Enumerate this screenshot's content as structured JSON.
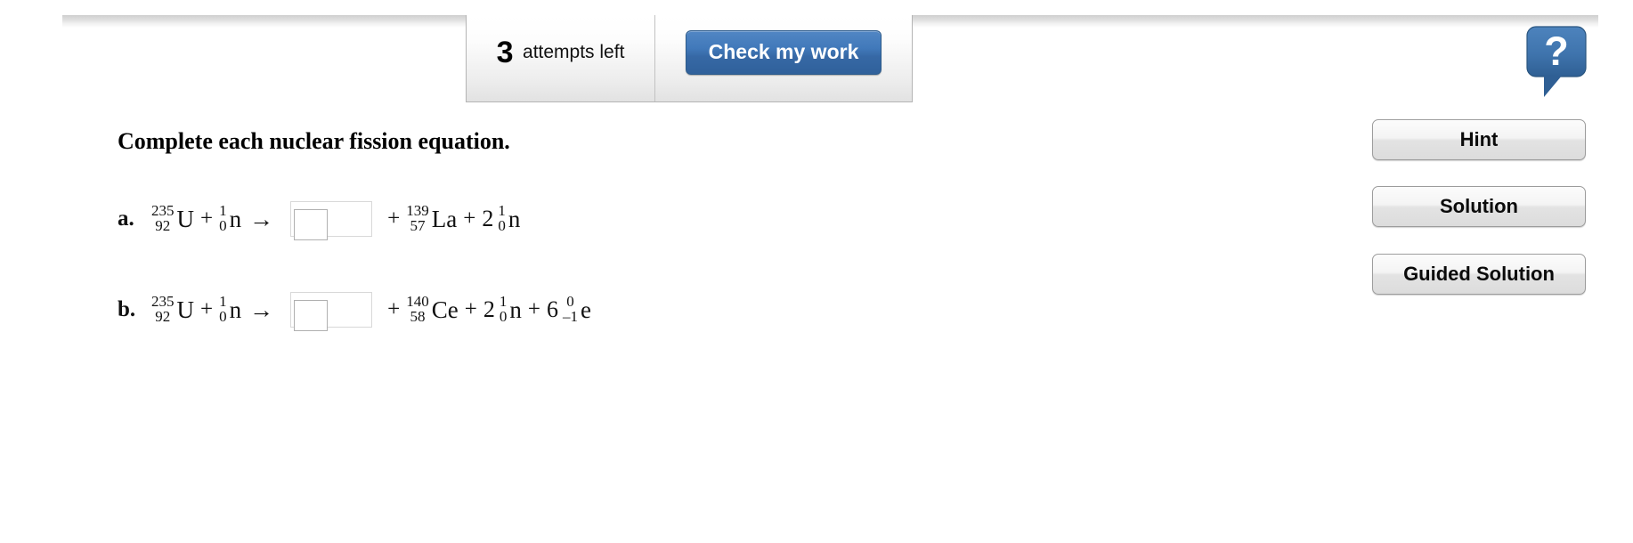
{
  "toolbar": {
    "attempts_count": "3",
    "attempts_label": "attempts left",
    "check_button_label": "Check my work"
  },
  "help": {
    "icon": "question-mark-speech-bubble-icon",
    "glyph": "?"
  },
  "question": {
    "title": "Complete each nuclear fission equation.",
    "equations": [
      {
        "label": "a.",
        "terms": [
          {
            "kind": "isotope",
            "mass": "235",
            "z": "92",
            "symbol": "U"
          },
          {
            "kind": "op",
            "text": "+"
          },
          {
            "kind": "isotope",
            "mass": "1",
            "z": "0",
            "symbol": "n"
          },
          {
            "kind": "arrow",
            "text": "→"
          },
          {
            "kind": "input",
            "value": ""
          },
          {
            "kind": "op",
            "text": "+"
          },
          {
            "kind": "isotope",
            "mass": "139",
            "z": "57",
            "symbol": "La"
          },
          {
            "kind": "op",
            "text": "+"
          },
          {
            "kind": "coef",
            "text": "2"
          },
          {
            "kind": "isotope",
            "mass": "1",
            "z": "0",
            "symbol": "n"
          }
        ]
      },
      {
        "label": "b.",
        "terms": [
          {
            "kind": "isotope",
            "mass": "235",
            "z": "92",
            "symbol": "U"
          },
          {
            "kind": "op",
            "text": "+"
          },
          {
            "kind": "isotope",
            "mass": "1",
            "z": "0",
            "symbol": "n"
          },
          {
            "kind": "arrow",
            "text": "→"
          },
          {
            "kind": "input",
            "value": ""
          },
          {
            "kind": "op",
            "text": "+"
          },
          {
            "kind": "isotope",
            "mass": "140",
            "z": "58",
            "symbol": "Ce"
          },
          {
            "kind": "op",
            "text": "+"
          },
          {
            "kind": "coef",
            "text": "2"
          },
          {
            "kind": "isotope",
            "mass": "1",
            "z": "0",
            "symbol": "n"
          },
          {
            "kind": "op",
            "text": "+"
          },
          {
            "kind": "coef",
            "text": "6"
          },
          {
            "kind": "isotope",
            "mass": "0",
            "z": "–1",
            "symbol": "e"
          }
        ]
      }
    ]
  },
  "side_actions": [
    {
      "key": "hint",
      "label": "Hint"
    },
    {
      "key": "solution",
      "label": "Solution"
    },
    {
      "key": "guided",
      "label": "Guided Solution"
    }
  ],
  "colors": {
    "accent_blue": "#3668a5",
    "panel_border": "#b4b4b4",
    "button_face": "#ededed"
  }
}
